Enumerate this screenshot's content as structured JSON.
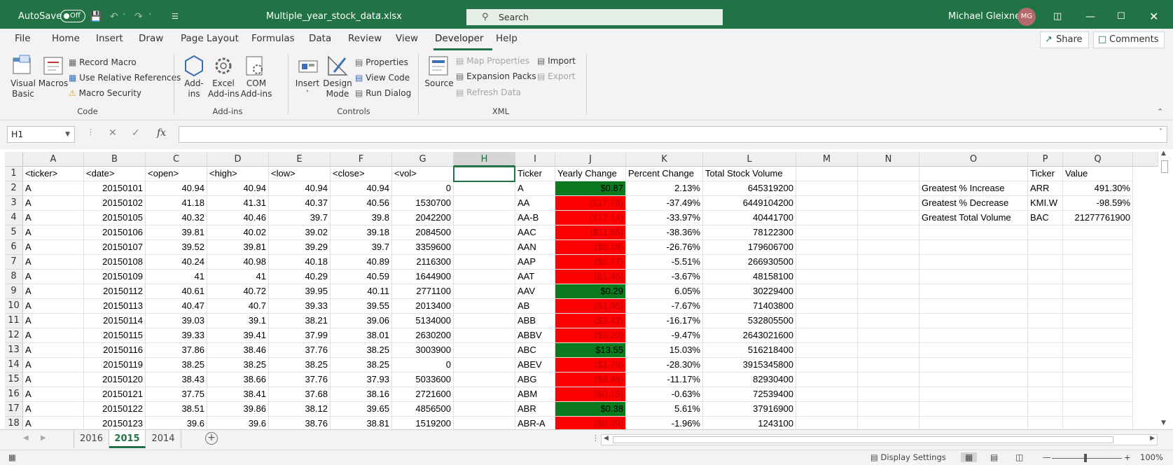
{
  "titlebar": {
    "autosave_label": "AutoSave",
    "autosave_state": "Off",
    "filename": "Multiple_year_stock_data.xlsx",
    "search_placeholder": "Search",
    "user_name": "Michael Gleixner",
    "user_initials": "MG",
    "accent": "#217346"
  },
  "menu": {
    "tabs": [
      "File",
      "Home",
      "Insert",
      "Draw",
      "Page Layout",
      "Formulas",
      "Data",
      "Review",
      "View",
      "Developer",
      "Help"
    ],
    "active": "Developer",
    "share_label": "Share",
    "comments_label": "Comments"
  },
  "ribbon": {
    "code": {
      "group": "Code",
      "visual_basic": [
        "Visual",
        "Basic"
      ],
      "macros": "Macros",
      "record_macro": "Record Macro",
      "relative_refs": "Use Relative References",
      "macro_security": "Macro Security"
    },
    "addins": {
      "group": "Add-ins",
      "addins": [
        "Add-",
        "ins"
      ],
      "excel_addins": [
        "Excel",
        "Add-ins"
      ],
      "com_addins": [
        "COM",
        "Add-ins"
      ]
    },
    "controls": {
      "group": "Controls",
      "insert": "Insert",
      "design_mode": [
        "Design",
        "Mode"
      ],
      "properties": "Properties",
      "view_code": "View Code",
      "run_dialog": "Run Dialog"
    },
    "xml": {
      "group": "XML",
      "source": "Source",
      "map_properties": "Map Properties",
      "expansion_packs": "Expansion Packs",
      "refresh_data": "Refresh Data",
      "import": "Import",
      "export": "Export"
    }
  },
  "formula_bar": {
    "name_box": "H1",
    "fx_label": "fx",
    "formula": ""
  },
  "grid": {
    "columns": [
      "A",
      "B",
      "C",
      "D",
      "E",
      "F",
      "G",
      "H",
      "I",
      "J",
      "K",
      "L",
      "M",
      "N",
      "O",
      "P",
      "Q"
    ],
    "selected_column": "H",
    "selected_cell": "H1",
    "rows": [
      "1",
      "2",
      "3",
      "4",
      "5",
      "6",
      "7",
      "8",
      "9",
      "10",
      "11",
      "12",
      "13",
      "14",
      "15",
      "16",
      "17",
      "18"
    ],
    "headers": [
      "<ticker>",
      "<date>",
      "<open>",
      "<high>",
      "<low>",
      "<close>",
      "<vol>"
    ],
    "data": [
      [
        "A",
        "20150101",
        "40.94",
        "40.94",
        "40.94",
        "40.94",
        "0"
      ],
      [
        "A",
        "20150102",
        "41.18",
        "41.31",
        "40.37",
        "40.56",
        "1530700"
      ],
      [
        "A",
        "20150105",
        "40.32",
        "40.46",
        "39.7",
        "39.8",
        "2042200"
      ],
      [
        "A",
        "20150106",
        "39.81",
        "40.02",
        "39.02",
        "39.18",
        "2084500"
      ],
      [
        "A",
        "20150107",
        "39.52",
        "39.81",
        "39.29",
        "39.7",
        "3359600"
      ],
      [
        "A",
        "20150108",
        "40.24",
        "40.98",
        "40.18",
        "40.89",
        "2116300"
      ],
      [
        "A",
        "20150109",
        "41",
        "41",
        "40.29",
        "40.59",
        "1644900"
      ],
      [
        "A",
        "20150112",
        "40.61",
        "40.72",
        "39.95",
        "40.11",
        "2771100"
      ],
      [
        "A",
        "20150113",
        "40.47",
        "40.7",
        "39.33",
        "39.55",
        "2013400"
      ],
      [
        "A",
        "20150114",
        "39.03",
        "39.1",
        "38.21",
        "39.06",
        "5134000"
      ],
      [
        "A",
        "20150115",
        "39.33",
        "39.41",
        "37.99",
        "38.01",
        "2630200"
      ],
      [
        "A",
        "20150116",
        "37.86",
        "38.46",
        "37.76",
        "38.25",
        "3003900"
      ],
      [
        "A",
        "20150119",
        "38.25",
        "38.25",
        "38.25",
        "38.25",
        "0"
      ],
      [
        "A",
        "20150120",
        "38.43",
        "38.66",
        "37.76",
        "37.93",
        "5033600"
      ],
      [
        "A",
        "20150121",
        "37.75",
        "38.41",
        "37.68",
        "38.16",
        "2721600"
      ],
      [
        "A",
        "20150122",
        "38.51",
        "39.86",
        "38.12",
        "39.65",
        "4856500"
      ],
      [
        "A",
        "20150123",
        "39.6",
        "39.6",
        "38.76",
        "38.81",
        "1519200"
      ]
    ],
    "summary_headers": [
      "Ticker",
      "Yearly Change",
      "Percent Change",
      "Total Stock Volume"
    ],
    "summary": [
      [
        "A",
        "$0.87",
        "2.13%",
        "645319200",
        "pos"
      ],
      [
        "AA",
        "($17.76)",
        "-37.49%",
        "6449104200",
        "neg"
      ],
      [
        "AA-B",
        "($17.14)",
        "-33.97%",
        "40441700",
        "neg"
      ],
      [
        "AAC",
        "($11.86)",
        "-38.36%",
        "78122300",
        "neg"
      ],
      [
        "AAN",
        "($8.18)",
        "-26.76%",
        "179606700",
        "neg"
      ],
      [
        "AAP",
        "($8.77)",
        "-5.51%",
        "266930500",
        "neg"
      ],
      [
        "AAT",
        "($1.46)",
        "-3.67%",
        "48158100",
        "neg"
      ],
      [
        "AAV",
        "$0.29",
        "6.05%",
        "30229400",
        "pos"
      ],
      [
        "AB",
        "($1.98)",
        "-7.67%",
        "71403800",
        "neg"
      ],
      [
        "ABB",
        "($3.42)",
        "-16.17%",
        "532805500",
        "neg"
      ],
      [
        "ABBV",
        "($6.20)",
        "-9.47%",
        "2643021600",
        "neg"
      ],
      [
        "ABC",
        "$13.55",
        "15.03%",
        "516218400",
        "pos"
      ],
      [
        "ABEV",
        "($1.76)",
        "-28.30%",
        "3915345800",
        "neg"
      ],
      [
        "ABG",
        "($8.48)",
        "-11.17%",
        "82930400",
        "neg"
      ],
      [
        "ABM",
        "($0.18)",
        "-0.63%",
        "72539400",
        "neg"
      ],
      [
        "ABR",
        "$0.38",
        "5.61%",
        "37916900",
        "pos"
      ],
      [
        "ABR-A",
        "($0.49)",
        "-1.96%",
        "1243100",
        "neg"
      ]
    ],
    "greatest_headers": [
      "Ticker",
      "Value"
    ],
    "greatest": [
      [
        "Greatest % Increase",
        "ARR",
        "491.30%"
      ],
      [
        "Greatest % Decrease",
        "KMI.W",
        "-98.59%"
      ],
      [
        "Greatest Total Volume",
        "BAC",
        "21277761900"
      ]
    ],
    "colors": {
      "positive": "#0b7a1e",
      "negative": "#ff0000"
    }
  },
  "sheets": {
    "tabs": [
      "2016",
      "2015",
      "2014"
    ],
    "active": "2015"
  },
  "statusbar": {
    "display_settings": "Display Settings",
    "zoom": "100%"
  }
}
